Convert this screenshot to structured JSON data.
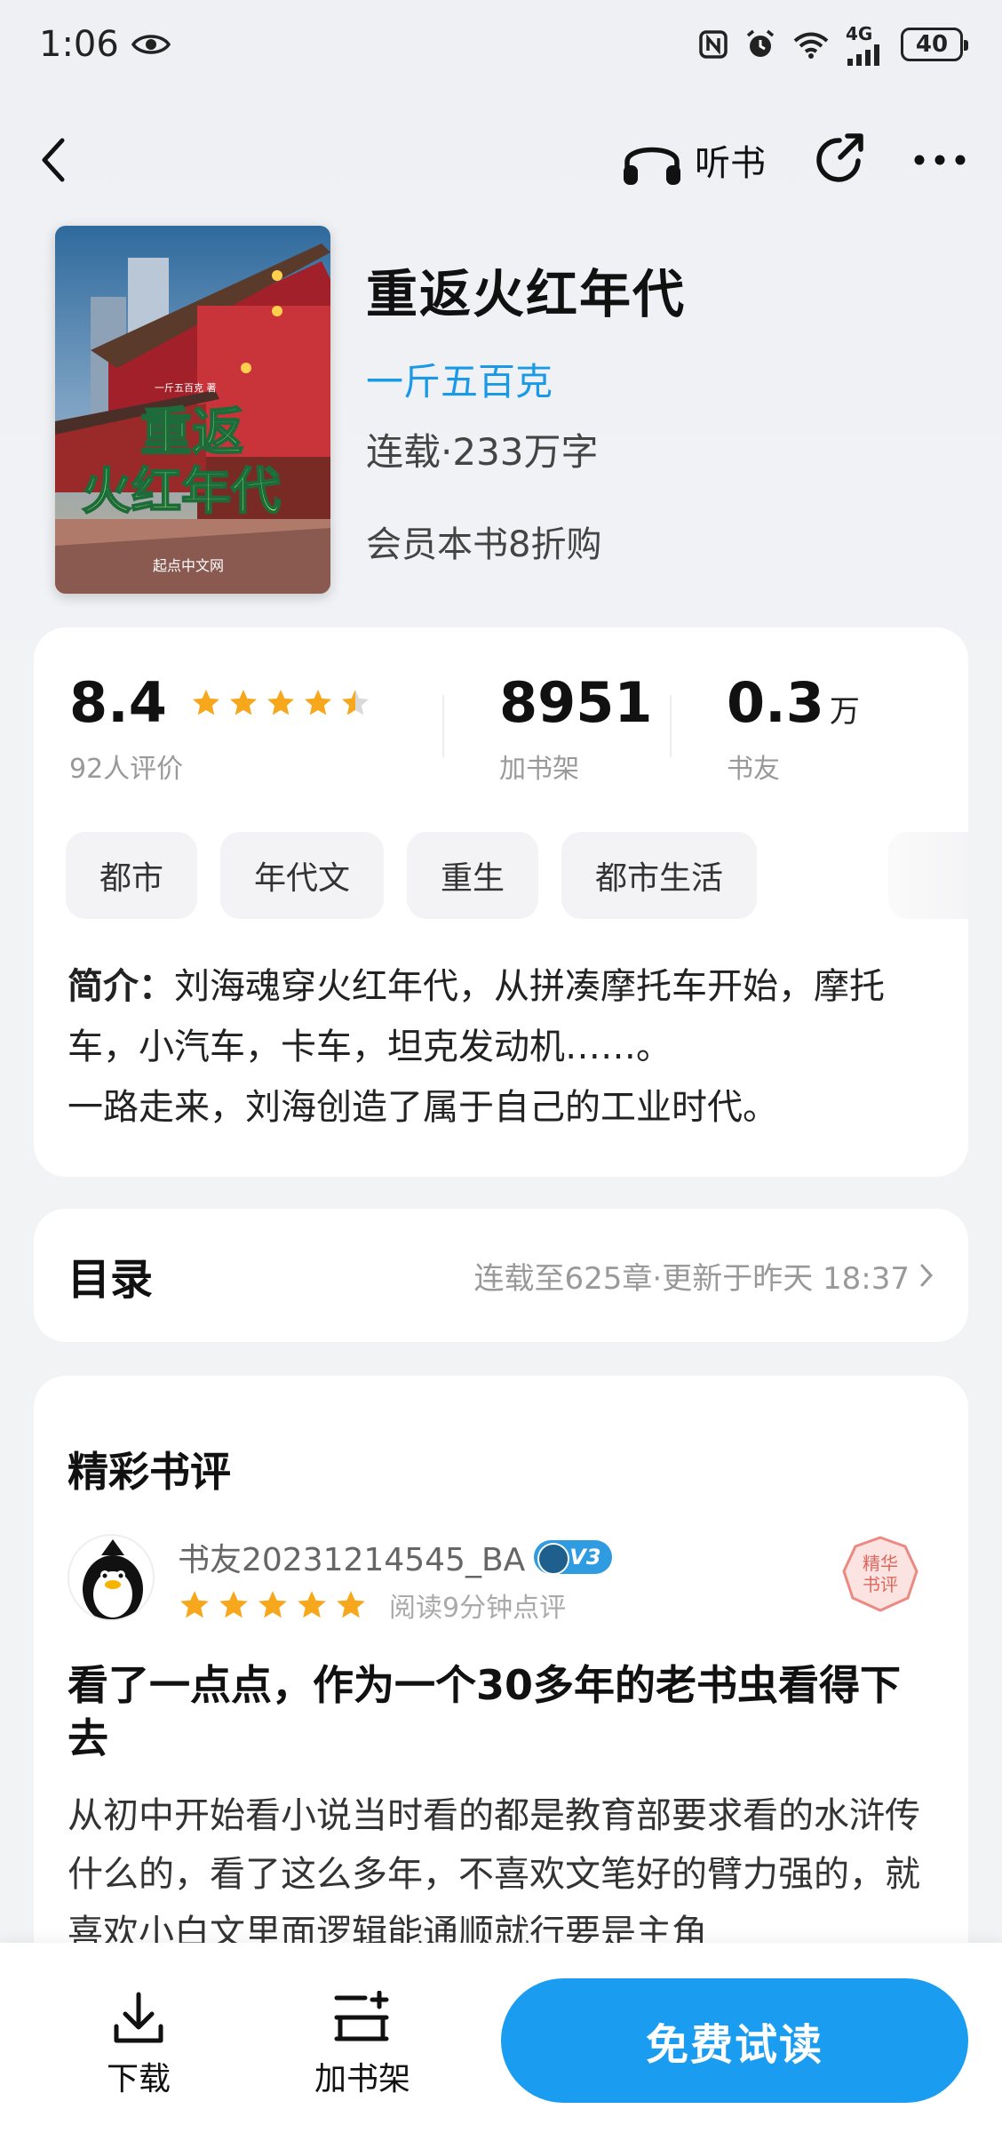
{
  "status_bar": {
    "time": "1:06",
    "network": "4G",
    "battery": "40"
  },
  "nav": {
    "listen_label": "听书"
  },
  "book": {
    "title": "重返火红年代",
    "author": "一斤五百克",
    "meta": "连载·233万字",
    "vip_offer": "会员本书8折购",
    "cover": {
      "title_line1": "重返",
      "title_line2": "火红年代",
      "author": "一斤五百克 著",
      "publisher": "起点中文网"
    }
  },
  "stats": {
    "rating": {
      "value": "8.4",
      "label": "92人评价",
      "stars": 4.5
    },
    "shelf": {
      "value": "8951",
      "label": "加书架"
    },
    "fans": {
      "value": "0.3",
      "unit": "万",
      "label": "书友"
    }
  },
  "tags": [
    "都市",
    "年代文",
    "重生",
    "都市生活"
  ],
  "intro": {
    "label": "简介：",
    "line1": "刘海魂穿火红年代，从拼凑摩托车开始，摩托车，小汽车，卡车，坦克发动机……。",
    "line2": "一路走来，刘海创造了属于自己的工业时代。"
  },
  "toc": {
    "title": "目录",
    "status": "连载至625章·更新于昨天 18:37"
  },
  "reviews": {
    "heading": "精彩书评",
    "items": [
      {
        "user": "书友20231214545_BA",
        "level": "V3",
        "stars": 5,
        "read_time": "阅读9分钟点评",
        "seal": [
          "精华",
          "书评"
        ],
        "title": "看了一点点，作为一个30多年的老书虫看得下去",
        "body": "从初中开始看小说当时看的都是教育部要求看的水浒传什么的，看了这么多年，不喜欢文笔好的臂力强的，就喜欢小白文里面逻辑能通顺就行要是主角"
      }
    ]
  },
  "bottom": {
    "download": "下载",
    "add_shelf": "加书架",
    "read_free": "免费试读"
  },
  "colors": {
    "accent": "#1a9df0",
    "author_link": "#1a9ae6",
    "star": "#f7a71b",
    "star_empty": "#d9d9d9",
    "vip_badge": "#2f9be0"
  }
}
